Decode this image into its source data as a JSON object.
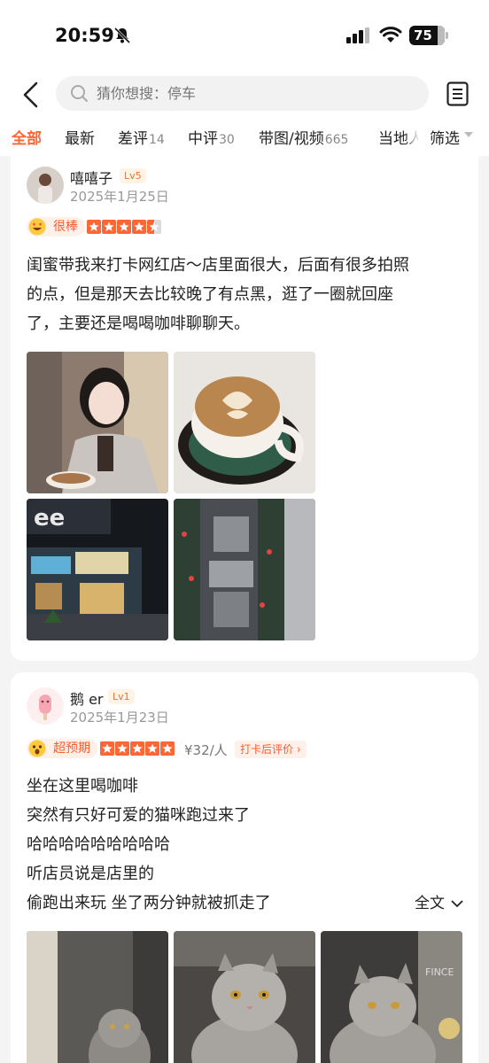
{
  "status": {
    "time": "20:59",
    "battery": "75"
  },
  "search": {
    "placeholder": "猜你想搜：停车"
  },
  "tabs": [
    {
      "label": "全部",
      "count": ""
    },
    {
      "label": "最新",
      "count": ""
    },
    {
      "label": "差评",
      "count": "14"
    },
    {
      "label": "中评",
      "count": "30"
    },
    {
      "label": "带图/视频",
      "count": "665"
    },
    {
      "label": "当地人",
      "count": ""
    }
  ],
  "filter_label": "筛选",
  "colors": {
    "accent": "#ff6633",
    "level_badge": "#e8742e",
    "star": "#ff6633"
  },
  "reviews": [
    {
      "user": "嘻嘻子",
      "level": "Lv5",
      "date": "2025年1月25日",
      "rating_label": "很棒",
      "stars": 4.5,
      "text_lines": [
        "闺蜜带我来打卡网红店～店里面很大，后面有很多拍照",
        "的点，但是那天去比较晚了有点黑，逛了一圈就回座",
        "了，主要还是喝喝咖啡聊聊天。"
      ],
      "photos": [
        "selfie-photo",
        "latte-art-photo",
        "storefront-night-photo",
        "decor-wall-photo"
      ]
    },
    {
      "user": "鹅 er",
      "level": "Lv1",
      "date": "2025年1月23日",
      "rating_label": "超预期",
      "stars": 5,
      "price": "¥32/人",
      "checkin_label": "打卡后评价",
      "text_lines": [
        "坐在这里喝咖啡",
        "突然有只好可爱的猫咪跑过来了",
        "哈哈哈哈哈哈哈哈哈",
        "听店员说是店里的",
        "偷跑出来玩 坐了两分钟就被抓走了"
      ],
      "full_text_label": "全文",
      "photos": [
        "cat-photo-1",
        "cat-photo-2",
        "cat-photo-3"
      ]
    }
  ]
}
